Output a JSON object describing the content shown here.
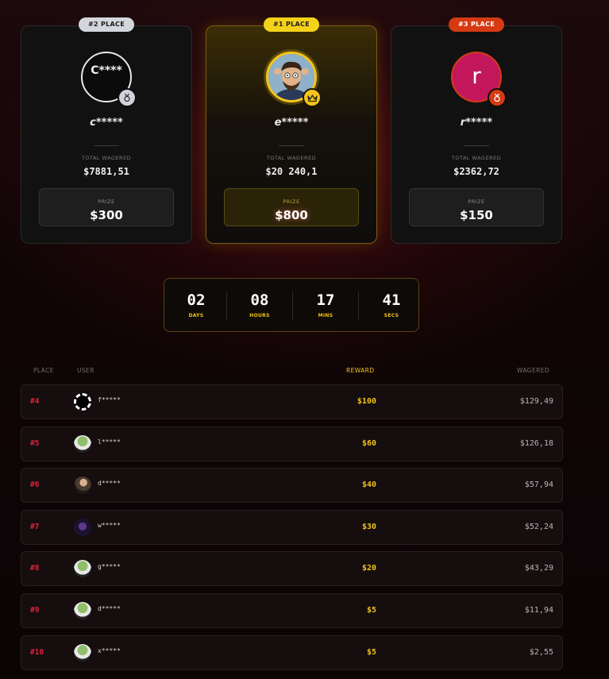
{
  "podium": [
    {
      "badge": "#2 PLACE",
      "badge_bg": "#d4d6dc",
      "badge_color": "#1a1a1a",
      "avatar_letter": "C****",
      "username": "c*****",
      "wagered_label": "TOTAL WAGERED",
      "wagered": "$7881,51",
      "prize_label": "PRIZE",
      "prize": "$300",
      "medal_icon": "silver-medal-icon"
    },
    {
      "badge": "#1 PLACE",
      "badge_bg": "#f5d21a",
      "badge_color": "#1a1a1a",
      "username": "e*****",
      "wagered_label": "TOTAL WAGERED",
      "wagered": "$20 240,1",
      "prize_label": "PRIZE",
      "prize": "$800",
      "medal_icon": "crown-icon"
    },
    {
      "badge": "#3 PLACE",
      "badge_bg": "#d53a12",
      "badge_color": "#ffffff",
      "avatar_letter": "r",
      "avatar_bg": "#c2185b",
      "username": "r*****",
      "wagered_label": "TOTAL WAGERED",
      "wagered": "$2362,72",
      "prize_label": "PRIZE",
      "prize": "$150",
      "medal_icon": "bronze-medal-icon"
    }
  ],
  "countdown": [
    {
      "value": "02",
      "label": "DAYS"
    },
    {
      "value": "08",
      "label": "HOURS"
    },
    {
      "value": "17",
      "label": "MINS"
    },
    {
      "value": "41",
      "label": "SECS"
    }
  ],
  "table": {
    "headers": {
      "place": "PLACE",
      "user": "USER",
      "reward": "REWARD",
      "wagered": "WAGERED"
    },
    "rows": [
      {
        "place": "#4",
        "user": "f*****",
        "reward": "$100",
        "wagered": "$129,49",
        "avatar": "ring-avatar"
      },
      {
        "place": "#5",
        "user": "l*****",
        "reward": "$60",
        "wagered": "$126,18",
        "avatar": "pepe-avatar"
      },
      {
        "place": "#6",
        "user": "d*****",
        "reward": "$40",
        "wagered": "$57,94",
        "avatar": "gun-avatar"
      },
      {
        "place": "#7",
        "user": "w*****",
        "reward": "$30",
        "wagered": "$52,24",
        "avatar": "dark-avatar"
      },
      {
        "place": "#8",
        "user": "g*****",
        "reward": "$20",
        "wagered": "$43,29",
        "avatar": "pepe-avatar"
      },
      {
        "place": "#9",
        "user": "d*****",
        "reward": "$5",
        "wagered": "$11,94",
        "avatar": "pepe-avatar"
      },
      {
        "place": "#10",
        "user": "x*****",
        "reward": "$5",
        "wagered": "$2,55",
        "avatar": "pepe-avatar"
      }
    ]
  },
  "colors": {
    "accent_gold": "#f0c419",
    "place_red": "#e0223a"
  }
}
